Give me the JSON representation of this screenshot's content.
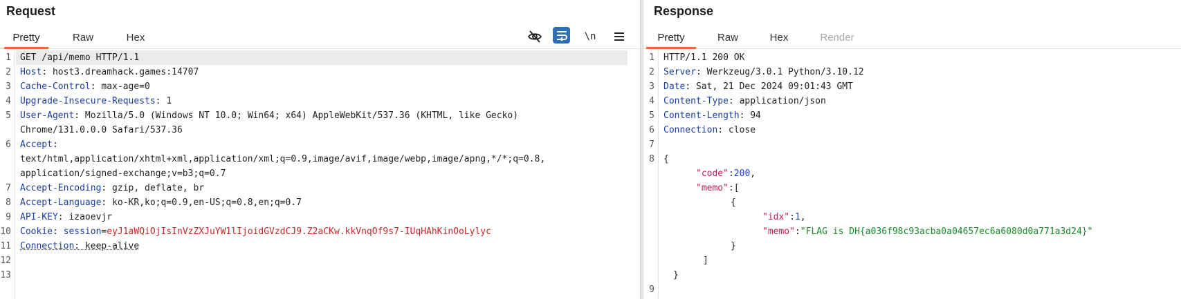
{
  "request": {
    "title": "Request",
    "tabs": [
      {
        "label": "Pretty",
        "active": true
      },
      {
        "label": "Raw",
        "active": false
      },
      {
        "label": "Hex",
        "active": false
      }
    ],
    "toolbar": {
      "hide_icon": "eye-off-icon",
      "wrap_icon": "wrap-lines-icon",
      "newline_label": "\\n",
      "menu_icon": "hamburger-menu-icon"
    },
    "line_numbers": [
      "1",
      "2",
      "3",
      "4",
      "5",
      "6",
      "7",
      "8",
      "9",
      "10",
      "11",
      "12",
      "13"
    ],
    "lines": {
      "l1": "GET /api/memo HTTP/1.1",
      "l2_key": "Host",
      "l2_val": ": host3.dreamhack.games:14707",
      "l3_key": "Cache-Control",
      "l3_val": ": max-age=0",
      "l4_key": "Upgrade-Insecure-Requests",
      "l4_val": ": 1",
      "l5_key": "User-Agent",
      "l5_val": ": Mozilla/5.0 (Windows NT 10.0; Win64; x64) AppleWebKit/537.36 (KHTML, like Gecko)",
      "l5_cont": "Chrome/131.0.0.0 Safari/537.36",
      "l6_key": "Accept",
      "l6_val": ":",
      "l6_cont1": "text/html,application/xhtml+xml,application/xml;q=0.9,image/avif,image/webp,image/apng,*/*;q=0.8,",
      "l6_cont2": "application/signed-exchange;v=b3;q=0.7",
      "l7_key": "Accept-Encoding",
      "l7_val": ": gzip, deflate, br",
      "l8_key": "Accept-Language",
      "l8_val": ": ko-KR,ko;q=0.9,en-US;q=0.8,en;q=0.7",
      "l9_key": "API-KEY",
      "l9_val": ": izaoevjr",
      "l10_key": "Cookie",
      "l10_sep": ": ",
      "l10_name": "session",
      "l10_eq": "=",
      "l10_val": "eyJ1aWQiOjIsInVzZXJuYW1lIjoidGVzdCJ9.Z2aCKw.kkVnqOf9s7-IUqHAhKinOoLylyc",
      "l11_key": "Connection",
      "l11_val": ": keep-alive"
    }
  },
  "response": {
    "title": "Response",
    "tabs": [
      {
        "label": "Pretty",
        "active": true
      },
      {
        "label": "Raw",
        "active": false
      },
      {
        "label": "Hex",
        "active": false
      },
      {
        "label": "Render",
        "active": false
      }
    ],
    "line_numbers": [
      "1",
      "2",
      "3",
      "4",
      "5",
      "6",
      "7",
      "8",
      "",
      "",
      "",
      "",
      "",
      "",
      "",
      "",
      "9"
    ],
    "lines": {
      "l1": "HTTP/1.1 200 OK",
      "l2_key": "Server",
      "l2_val": ": Werkzeug/3.0.1 Python/3.10.12",
      "l3_key": "Date",
      "l3_val": ": Sat, 21 Dec 2024 09:01:43 GMT",
      "l4_key": "Content-Type",
      "l4_val": ": application/json",
      "l5_key": "Content-Length",
      "l5_val": ": 94",
      "l6_key": "Connection",
      "l6_val": ": close",
      "j_open": "{",
      "j_code_key": "\"code\"",
      "j_code_colon": ":",
      "j_code_val": "200",
      "j_code_comma": ",",
      "j_memo_key": "\"memo\"",
      "j_memo_open": ":[",
      "j_obj_open": "{",
      "j_idx_key": "\"idx\"",
      "j_idx_colon": ":",
      "j_idx_val": "1",
      "j_idx_comma": ",",
      "j_memo2_key": "\"memo\"",
      "j_memo2_colon": ":",
      "j_memo2_val": "\"FLAG is DH{a036f98c93acba0a04657ec6a6080d0a771a3d24}\"",
      "j_obj_close": "}",
      "j_arr_close": "]",
      "j_close": "}"
    }
  },
  "colors": {
    "accent_tab_underline": "#e86a33",
    "header_key": "#1b3fa0",
    "cookie_value": "#c62828",
    "json_key": "#c2185b",
    "json_number": "#1e40d8",
    "json_string": "#1a8a2a",
    "wrap_button_bg": "#2f6db5"
  }
}
